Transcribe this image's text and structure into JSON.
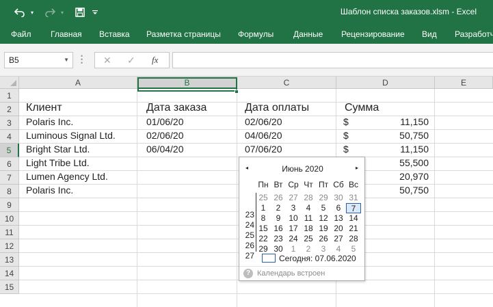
{
  "window": {
    "title": "Шаблон списка заказов.xlsm  -  Excel",
    "quick_access": [
      "undo-icon",
      "redo-icon",
      "save-icon",
      "customize-icon"
    ]
  },
  "ribbon": {
    "tabs": [
      "Файл",
      "Главная",
      "Вставка",
      "Разметка страницы",
      "Формулы",
      "Данные",
      "Рецензирование",
      "Вид",
      "Разработч"
    ]
  },
  "formula_bar": {
    "name_box": "B5",
    "fx_label": "fx",
    "value": ""
  },
  "sheet": {
    "columns": [
      "A",
      "B",
      "C",
      "D",
      "E"
    ],
    "selected_column": "B",
    "selected_row": "5",
    "rows": [
      "1",
      "2",
      "3",
      "4",
      "5",
      "6",
      "7",
      "8",
      "9",
      "10",
      "11",
      "12",
      "13",
      "14",
      "15"
    ],
    "headers": {
      "client": "Клиент",
      "order_date": "Дата заказа",
      "payment_date": "Дата оплаты",
      "amount": "Сумма"
    },
    "data": [
      {
        "client": "Polaris Inc.",
        "order_date": "01/06/20",
        "payment_date": "02/06/20",
        "currency": "$",
        "amount": "11,150"
      },
      {
        "client": "Luminous Signal Ltd.",
        "order_date": "02/06/20",
        "payment_date": "04/06/20",
        "currency": "$",
        "amount": "50,750"
      },
      {
        "client": "Bright Star Ltd.",
        "order_date": "06/04/20",
        "payment_date": "07/06/20",
        "currency": "$",
        "amount": "11,150"
      },
      {
        "client": "Light Tribe Ltd.",
        "order_date": "",
        "payment_date": "",
        "currency": "",
        "amount": "55,500"
      },
      {
        "client": "Lumen Agency Ltd.",
        "order_date": "",
        "payment_date": "",
        "currency": "",
        "amount": "20,970"
      },
      {
        "client": "Polaris Inc.",
        "order_date": "",
        "payment_date": "",
        "currency": "",
        "amount": "50,750"
      }
    ]
  },
  "calendar": {
    "prev": "◂",
    "next": "▸",
    "month_label": "Июнь 2020",
    "weekdays": [
      "Пн",
      "Вт",
      "Ср",
      "Чт",
      "Пт",
      "Сб",
      "Вс"
    ],
    "weeks": [
      {
        "num": "",
        "days": [
          "25",
          "26",
          "27",
          "28",
          "29",
          "30",
          "31"
        ]
      },
      {
        "num": "23",
        "days": [
          "1",
          "2",
          "3",
          "4",
          "5",
          "6",
          "7"
        ]
      },
      {
        "num": "24",
        "days": [
          "8",
          "9",
          "10",
          "11",
          "12",
          "13",
          "14"
        ]
      },
      {
        "num": "25",
        "days": [
          "15",
          "16",
          "17",
          "18",
          "19",
          "20",
          "21"
        ]
      },
      {
        "num": "26",
        "days": [
          "22",
          "23",
          "24",
          "25",
          "26",
          "27",
          "28"
        ]
      },
      {
        "num": "27",
        "days": [
          "29",
          "30",
          "1",
          "2",
          "3",
          "4",
          "5"
        ]
      }
    ],
    "other_month_cells": [
      [
        0,
        0
      ],
      [
        0,
        1
      ],
      [
        0,
        2
      ],
      [
        0,
        3
      ],
      [
        0,
        4
      ],
      [
        0,
        5
      ],
      [
        0,
        6
      ],
      [
        5,
        2
      ],
      [
        5,
        3
      ],
      [
        5,
        4
      ],
      [
        5,
        5
      ],
      [
        5,
        6
      ]
    ],
    "selected_day": "7",
    "today_label": "Сегодня: 07.06.2020",
    "footer": "Календарь встроен"
  }
}
